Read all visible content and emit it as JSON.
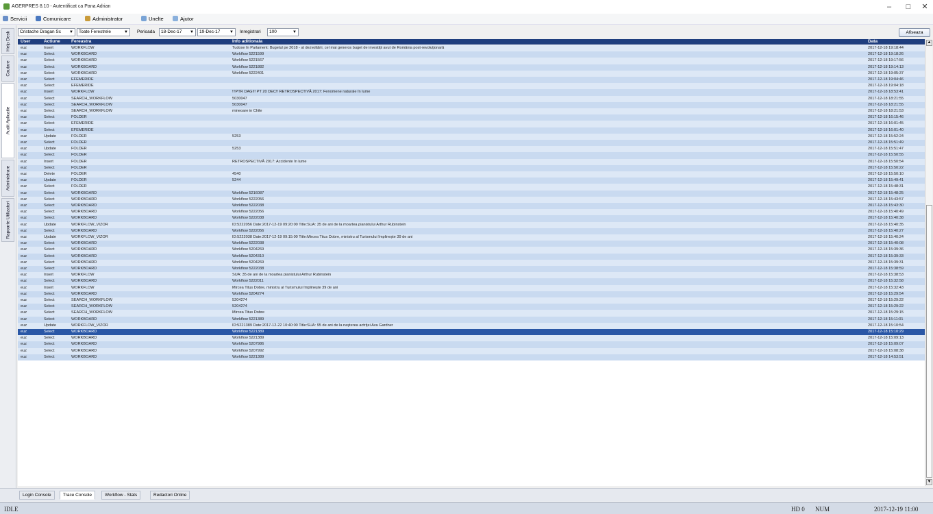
{
  "window": {
    "title": "AGERPRES 8.10 - Autentificat ca Pana Adrian",
    "minimize": "–",
    "maximize": "□",
    "close": "✕"
  },
  "menu": {
    "items": [
      {
        "label": "Servicii",
        "icon": "services-icon",
        "color": "#6a8fc8"
      },
      {
        "label": "Comunicare",
        "icon": "user-icon",
        "color": "#4a78c0"
      },
      {
        "label": "Administrator",
        "icon": "admin-icon",
        "color": "#c99b3a"
      },
      {
        "label": "Unelte",
        "icon": "tools-icon",
        "color": "#7aa4d6"
      },
      {
        "label": "Ajutor",
        "icon": "help-icon",
        "color": "#8ab0dc"
      }
    ]
  },
  "sidebar": {
    "tabs": [
      {
        "label": "Help Desk",
        "active": false
      },
      {
        "label": "Cautare",
        "active": false
      },
      {
        "label": "Audit Aplicatie",
        "active": true
      },
      {
        "label": "Administrare",
        "active": false
      },
      {
        "label": "Rapoarte Utilizatori",
        "active": false
      }
    ]
  },
  "filters": {
    "user_value": "Cristache Dragan Sc",
    "window_value": "Toate Ferestrele",
    "period_label": "Perioada",
    "date_from": "18-Dec-17",
    "date_to": "19-Dec-17",
    "records_label": "Inregistrari",
    "records_value": "100",
    "refresh_label": "Afiseaza"
  },
  "table": {
    "columns": [
      "User",
      "Actiune",
      "Fereastra",
      "Info aditionala",
      "Data"
    ],
    "selected_index": 45,
    "rows": [
      [
        "euz",
        "Insert",
        "WORKFLOW",
        "Tudose în Parlament: Bugetul pe 2018 - al dezvoltării, cel mai generos buget de investiții avut de România post-revoluționară",
        "2017-12-18 19:18:44"
      ],
      [
        "euz",
        "Select",
        "WORKBOARD",
        "Workflow 5221599",
        "2017-12-18 19:18:26"
      ],
      [
        "euz",
        "Select",
        "WORKBOARD",
        "Workflow 5221567",
        "2017-12-18 19:17:56"
      ],
      [
        "euz",
        "Select",
        "WORKBOARD",
        "Workflow 5221882",
        "2017-12-18 19:14:13"
      ],
      [
        "euz",
        "Select",
        "WORKBOARD",
        "Workflow 5222401",
        "2017-12-18 19:05:37"
      ],
      [
        "euz",
        "Select",
        "EFEMERIDE",
        "",
        "2017-12-18 19:04:46"
      ],
      [
        "euz",
        "Select",
        "EFEMERIDE",
        "",
        "2017-12-18 19:04:18"
      ],
      [
        "euz",
        "Insert",
        "WORKFLOW",
        "!!!PTR DAGI!! PT 20 DEC!! RETROSPECTIVĂ 2017: Fenomene naturale în lume",
        "2017-12-18 18:53:41"
      ],
      [
        "euz",
        "Select",
        "SEARCH_WORKFLOW",
        "5030047",
        "2017-12-18 18:21:55"
      ],
      [
        "euz",
        "Select",
        "SEARCH_WORKFLOW",
        "5030047",
        "2017-12-18 18:21:55"
      ],
      [
        "euz",
        "Select",
        "SEARCH_WORKFLOW",
        "mineoare in Chile",
        "2017-12-18 18:21:53"
      ],
      [
        "euz",
        "Select",
        "FOLDER",
        "",
        "2017-12-18 16:15:46"
      ],
      [
        "euz",
        "Select",
        "EFEMERIDE",
        "",
        "2017-12-18 16:01:45"
      ],
      [
        "euz",
        "Select",
        "EFEMERIDE",
        "",
        "2017-12-18 16:01:40"
      ],
      [
        "euz",
        "Update",
        "FOLDER",
        "5253",
        "2017-12-18 15:52:24"
      ],
      [
        "euz",
        "Select",
        "FOLDER",
        "",
        "2017-12-18 15:51:49"
      ],
      [
        "euz",
        "Update",
        "FOLDER",
        "5253",
        "2017-12-18 15:51:47"
      ],
      [
        "euz",
        "Select",
        "FOLDER",
        "",
        "2017-12-18 15:50:55"
      ],
      [
        "euz",
        "Insert",
        "FOLDER",
        "RETROSPECTIVĂ 2017: Accidente în lume",
        "2017-12-18 15:50:54"
      ],
      [
        "euz",
        "Select",
        "FOLDER",
        "",
        "2017-12-18 15:50:22"
      ],
      [
        "euz",
        "Delete",
        "FOLDER",
        "4540",
        "2017-12-18 15:50:10"
      ],
      [
        "euz",
        "Update",
        "FOLDER",
        "5244",
        "2017-12-18 15:49:41"
      ],
      [
        "euz",
        "Select",
        "FOLDER",
        "",
        "2017-12-18 15:48:31"
      ],
      [
        "euz",
        "Select",
        "WORKBOARD",
        "Workflow 5216087",
        "2017-12-18 15:48:25"
      ],
      [
        "euz",
        "Select",
        "WORKBOARD",
        "Workflow 5222056",
        "2017-12-18 15:43:57"
      ],
      [
        "euz",
        "Select",
        "WORKBOARD",
        "Workflow 5222038",
        "2017-12-18 15:43:30"
      ],
      [
        "euz",
        "Select",
        "WORKBOARD",
        "Workflow 5222056",
        "2017-12-18 15:40:49"
      ],
      [
        "euz",
        "Select",
        "WORKBOARD",
        "Workflow 5222038",
        "2017-12-18 15:40:38"
      ],
      [
        "euz",
        "Update",
        "WORKFLOW_VIZOR",
        "ID:5222056 Date:2017-12-19 09:20:00 Title:SUA: 35 de ani de la moartea pianistului Arthur Rubinstein",
        "2017-12-18 15:40:35"
      ],
      [
        "euz",
        "Select",
        "WORKBOARD",
        "Workflow 5222056",
        "2017-12-18 15:40:27"
      ],
      [
        "euz",
        "Update",
        "WORKFLOW_VIZOR",
        "ID:5222038 Date:2017-12-19 09:15:00 Title:Mircea Titus Dobre, ministru al Turismului împlinește 39 de ani",
        "2017-12-18 15:40:24"
      ],
      [
        "euz",
        "Select",
        "WORKBOARD",
        "Workflow 5222038",
        "2017-12-18 15:40:08"
      ],
      [
        "euz",
        "Select",
        "WORKBOARD",
        "Workflow 5204269",
        "2017-12-18 15:39:36"
      ],
      [
        "euz",
        "Select",
        "WORKBOARD",
        "Workflow 5204310",
        "2017-12-18 15:39:33"
      ],
      [
        "euz",
        "Select",
        "WORKBOARD",
        "Workflow 5204269",
        "2017-12-18 15:39:31"
      ],
      [
        "euz",
        "Select",
        "WORKBOARD",
        "Workflow 5222038",
        "2017-12-18 15:38:59"
      ],
      [
        "euz",
        "Insert",
        "WORKFLOW",
        "SUA: 35 de ani de la moartea pianistului Arthur Rubinstein",
        "2017-12-18 15:38:53"
      ],
      [
        "euz",
        "Select",
        "WORKBOARD",
        "Workflow 5222011",
        "2017-12-18 15:32:58"
      ],
      [
        "euz",
        "Insert",
        "WORKFLOW",
        "Mircea Titus Dobre, ministru al Turismului împlinește 39 de ani",
        "2017-12-18 15:32:43"
      ],
      [
        "euz",
        "Select",
        "WORKBOARD",
        "Workflow 5204274",
        "2017-12-18 15:29:54"
      ],
      [
        "euz",
        "Select",
        "SEARCH_WORKFLOW",
        "5204274",
        "2017-12-18 15:29:22"
      ],
      [
        "euz",
        "Select",
        "SEARCH_WORKFLOW",
        "5204274",
        "2017-12-18 15:29:22"
      ],
      [
        "euz",
        "Select",
        "SEARCH_WORKFLOW",
        "Mircea Titus Dobre",
        "2017-12-18 15:29:15"
      ],
      [
        "euz",
        "Select",
        "WORKBOARD",
        "Workflow 5221389",
        "2017-12-18 15:11:01"
      ],
      [
        "euz",
        "Update",
        "WORKFLOW_VIZOR",
        "ID:5221389 Date:2017-12-22 10:40:00 Title:SUA: 95 de ani de la nașterea actriței Ava Gardner",
        "2017-12-18 15:10:54"
      ],
      [
        "euz",
        "Select",
        "WORKBOARD",
        "Workflow 5221389",
        "2017-12-18 15:10:29"
      ],
      [
        "euz",
        "Select",
        "WORKBOARD",
        "Workflow 5221389",
        "2017-12-18 15:09:13"
      ],
      [
        "euz",
        "Select",
        "WORKBOARD",
        "Workflow 5207986",
        "2017-12-18 15:09:07"
      ],
      [
        "euz",
        "Select",
        "WORKBOARD",
        "Workflow 5207992",
        "2017-12-18 15:08:38"
      ],
      [
        "euz",
        "Select",
        "WORKBOARD",
        "Workflow 5221389",
        "2017-12-18 14:53:51"
      ]
    ]
  },
  "scrollbar": {
    "up": "▲",
    "down": "▼"
  },
  "bottom_tabs": [
    {
      "label": "Login Console",
      "active": false
    },
    {
      "label": "Trace Console",
      "active": true
    },
    {
      "label": "Workflow - Stats",
      "active": false
    },
    {
      "label": "Redactori Online",
      "active": false
    }
  ],
  "status": {
    "state": "IDLE",
    "hd": "HD 0",
    "num": "NUM",
    "datetime": "2017-12-19 11:00"
  }
}
